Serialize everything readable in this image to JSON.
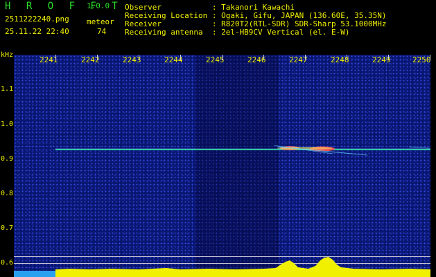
{
  "header": {
    "app_title": "H R O F F T",
    "version": "1.0.0",
    "filename": "2511222240.png",
    "meteor_label": "meteor",
    "datetime": "25.11.22 22:40",
    "meteor_count": "74",
    "info": [
      "Observer           : Takanori Kawachi",
      "Receiving Location : Ogaki, Gifu, JAPAN (136.60E, 35.35N)",
      "Receiver           : R820T2(RTL-SDR) SDR-Sharp 53.1000MHz",
      "Receiving antenna  : 2el-HB9CV Vertical (el. E-W)"
    ]
  },
  "axes": {
    "y_unit": "kHz",
    "y_ticks": [
      "1.1",
      "1.0",
      "0.9",
      "0.8",
      "0.7",
      "0.6"
    ],
    "x_ticks": [
      "2241",
      "2242",
      "2243",
      "2244",
      "2245",
      "2246",
      "2247",
      "2248",
      "2249",
      "2250"
    ]
  },
  "colors": {
    "label": "#f0f000",
    "title": "#28e028",
    "signal": "#28e8a0",
    "meteor": "#ff5050",
    "power": "#f0f000",
    "power_base": "#28a0f0"
  }
}
